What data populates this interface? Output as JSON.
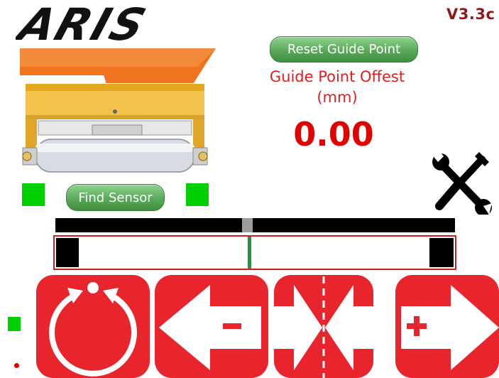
{
  "app": {
    "brand": "ARIS",
    "version": "V3.3c"
  },
  "guide": {
    "reset_label": "Reset Guide Point",
    "offset_label_line1": "Guide Point Offest",
    "offset_label_line2": "(mm)",
    "offset_value": "0.00"
  },
  "sensor": {
    "find_label": "Find Sensor"
  },
  "colors": {
    "accent_red": "#e8242c",
    "indicator_green": "#00d000",
    "button_green": "#5aa95a",
    "value_red": "#e00000",
    "version_text": "#8b1a1a"
  },
  "controls": [
    {
      "name": "auto-mode",
      "icon": "power-circle-icon"
    },
    {
      "name": "move-left",
      "icon": "arrow-left-minus-icon"
    },
    {
      "name": "center",
      "icon": "center-arrows-icon"
    },
    {
      "name": "move-right",
      "icon": "arrow-right-plus-icon"
    }
  ],
  "icons": {
    "settings": "wrench-screwdriver-icon"
  }
}
